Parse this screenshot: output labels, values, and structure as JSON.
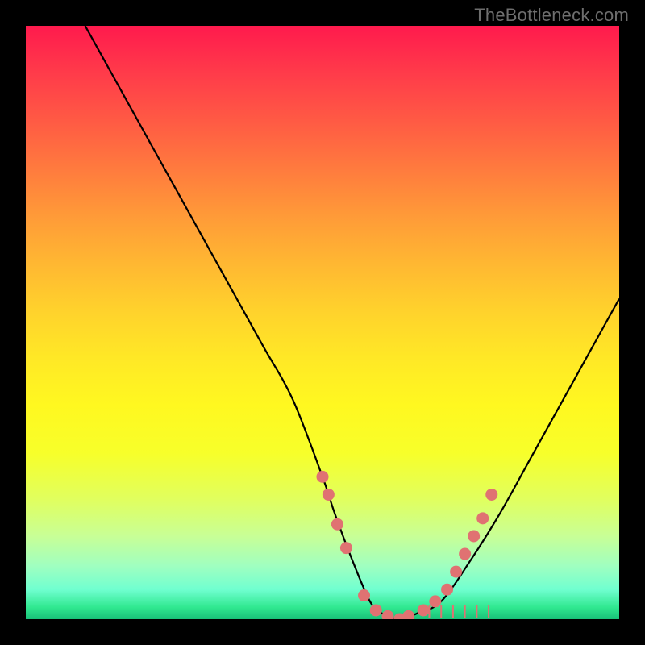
{
  "watermark": "TheBottleneck.com",
  "chart_data": {
    "type": "line",
    "title": "",
    "xlabel": "",
    "ylabel": "",
    "xlim": [
      0,
      100
    ],
    "ylim": [
      0,
      100
    ],
    "grid": false,
    "legend": false,
    "background_gradient": {
      "top": "#ff1a4d",
      "upper_mid": "#ffb732",
      "lower_mid": "#fff820",
      "bottom": "#18c078"
    },
    "series": [
      {
        "name": "bottleneck-curve",
        "color": "#000000",
        "x": [
          10,
          15,
          20,
          25,
          30,
          35,
          40,
          45,
          50,
          52,
          55,
          58,
          60,
          63,
          66,
          70,
          75,
          80,
          85,
          90,
          95,
          100
        ],
        "y": [
          100,
          91,
          82,
          73,
          64,
          55,
          46,
          37,
          24,
          18,
          10,
          3,
          1,
          0,
          1,
          3,
          10,
          18,
          27,
          36,
          45,
          54
        ]
      }
    ],
    "markers": {
      "name": "highlight-dots",
      "color": "#e07272",
      "points": [
        {
          "x": 50.0,
          "y": 24
        },
        {
          "x": 51.0,
          "y": 21
        },
        {
          "x": 52.5,
          "y": 16
        },
        {
          "x": 54.0,
          "y": 12
        },
        {
          "x": 57.0,
          "y": 4
        },
        {
          "x": 59.0,
          "y": 1.5
        },
        {
          "x": 61.0,
          "y": 0.5
        },
        {
          "x": 63.0,
          "y": 0
        },
        {
          "x": 64.5,
          "y": 0.5
        },
        {
          "x": 67.0,
          "y": 1.5
        },
        {
          "x": 69.0,
          "y": 3
        },
        {
          "x": 71.0,
          "y": 5
        },
        {
          "x": 72.5,
          "y": 8
        },
        {
          "x": 74.0,
          "y": 11
        },
        {
          "x": 75.5,
          "y": 14
        },
        {
          "x": 77.0,
          "y": 17
        },
        {
          "x": 78.5,
          "y": 21
        }
      ]
    },
    "axis_ticks": {
      "name": "bottom-ticks",
      "color": "#e07272",
      "x": [
        68,
        70,
        72,
        74,
        76,
        78
      ]
    }
  }
}
